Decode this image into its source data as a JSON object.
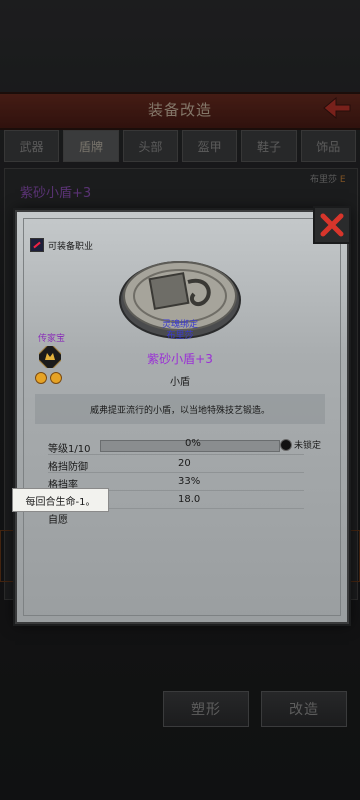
{
  "header": {
    "title": "装备改造"
  },
  "tabs": [
    {
      "label": "武器"
    },
    {
      "label": "盾牌"
    },
    {
      "label": "头部"
    },
    {
      "label": "盔甲"
    },
    {
      "label": "鞋子"
    },
    {
      "label": "饰品"
    }
  ],
  "background_panel": {
    "item_name": "紫砂小盾+3",
    "tag": "布里莎",
    "tag_suffix": "E"
  },
  "buttons": {
    "reshape": "塑形",
    "modify": "改造"
  },
  "modal": {
    "equippable_job_label": "可装备职业",
    "heirloom_label": "传家宝",
    "bind_line1": "灵魂绑定",
    "bind_line2": "布里莎",
    "item_name": "紫砂小盾+3",
    "item_type": "小盾",
    "description": "威弗提亚流行的小盾，以当地特殊技艺锻造。",
    "level": {
      "label": "等级1/10",
      "progress_percent": 0,
      "percent_text": "0%",
      "lock_label": "未锁定"
    },
    "stats": [
      {
        "label": "格挡防御",
        "value": "20"
      },
      {
        "label": "格挡率",
        "value": "33%"
      },
      {
        "label": "",
        "value": "18.0"
      },
      {
        "label": "自愿",
        "value": ""
      }
    ],
    "tooltip": "每回合生命-1。"
  },
  "colors": {
    "accent_purple": "#9a2fd6",
    "header_red": "#6a2b20",
    "lock_red": "#cc3333"
  }
}
